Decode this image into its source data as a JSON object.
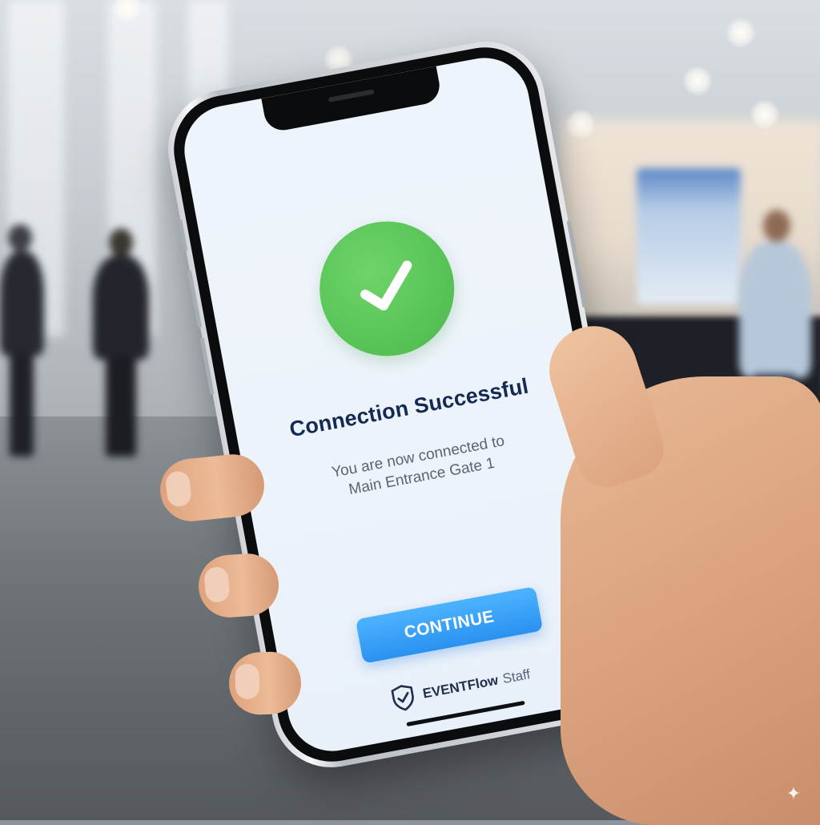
{
  "screen": {
    "title": "Connection Successful",
    "message_line1": "You are now connected to",
    "message_line2": "Main Entrance Gate 1",
    "status_icon": "checkmark-icon",
    "status_color": "#58c457",
    "continue_label": "CONTINUE",
    "button_color": "#2a91f0"
  },
  "brand": {
    "name": "EVENTFlow",
    "suffix": "Staff",
    "icon": "shield-check-icon"
  },
  "decor": {
    "watermark_icon": "sparkle-icon"
  }
}
